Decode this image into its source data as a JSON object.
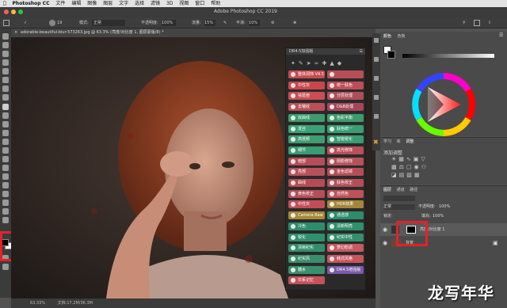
{
  "menubar": {
    "apple": "",
    "app": "Photoshop CC",
    "items": [
      "文件",
      "编辑",
      "图像",
      "图层",
      "文字",
      "选择",
      "滤镜",
      "3D",
      "视图",
      "窗口",
      "帮助"
    ]
  },
  "window": {
    "title": "Adobe Photoshop CC 2019"
  },
  "options": {
    "brush_size": "19",
    "mode_label": "模式:",
    "mode_value": "正常",
    "opacity_label": "不透明度:",
    "opacity_value": "100%",
    "flow_label": "流量:",
    "flow_value": "15%",
    "smooth_label": "平滑:",
    "smooth_value": "10%"
  },
  "document": {
    "tab": "adorable-beautiful-blur-573263.jpg @ 63.3% (亮度/对比度 1, 图层蒙版/8) *"
  },
  "status": {
    "zoom": "63.33%",
    "doc": "文档:17.2M/36.3M"
  },
  "plugin": {
    "title": "DR4.5加强版",
    "left_buttons": [
      {
        "label": "整体润饰 V4.5",
        "color": "#c94a4e"
      },
      {
        "label": "中性灰",
        "color": "#c9474c"
      },
      {
        "label": "祛斑痘",
        "color": "#c94f55"
      },
      {
        "label": "去皱纹",
        "color": "#ba4f57"
      },
      {
        "label": "双曲线",
        "color": "#3f9b6e"
      },
      {
        "label": "发丝",
        "color": "#3aa276"
      },
      {
        "label": "高低频",
        "color": "#3e9d71"
      },
      {
        "label": "细节",
        "color": "#3a9c73"
      },
      {
        "label": "暗部",
        "color": "#b54e59"
      },
      {
        "label": "亮部",
        "color": "#b6525a"
      },
      {
        "label": "曲线",
        "color": "#b64b54"
      },
      {
        "label": "黄色校正",
        "color": "#b54e58"
      },
      {
        "label": "中性灰",
        "color": "#c34d55"
      },
      {
        "label": "Camera Raw",
        "color": "#a98838"
      },
      {
        "label": "冷色",
        "color": "#2d8c6c"
      },
      {
        "label": "锐化",
        "color": "#2f8f6e"
      },
      {
        "label": "清晰纪实",
        "color": "#338e6d"
      },
      {
        "label": "纪实风",
        "color": "#3a8e6c"
      },
      {
        "label": "糖水",
        "color": "#3a8f6e"
      },
      {
        "label": "日系记忆",
        "color": "#c4525a"
      }
    ],
    "right_buttons": [
      {
        "label": "",
        "color": "#b94e57"
      },
      {
        "label": "统一肤色",
        "color": "#bd4e57"
      },
      {
        "label": "分层处理",
        "color": "#ad4f5a"
      },
      {
        "label": "D&B处理",
        "color": "#a4475a"
      },
      {
        "label": "色彩平衡",
        "color": "#3f9b6e"
      },
      {
        "label": "肤色统一",
        "color": "#3a9e73"
      },
      {
        "label": "智能锐化",
        "color": "#3a9c73"
      },
      {
        "label": "高光修饰",
        "color": "#b85059"
      },
      {
        "label": "阴影修饰",
        "color": "#b6535a"
      },
      {
        "label": "金色滤镜",
        "color": "#b54d57"
      },
      {
        "label": "肤色校正",
        "color": "#b34d58"
      },
      {
        "label": "自然色",
        "color": "#be525a"
      },
      {
        "label": "HDR效果",
        "color": "#a58638"
      },
      {
        "label": "通透感",
        "color": "#2d8c6c"
      },
      {
        "label": "清新明亮",
        "color": "#2f8f6e"
      },
      {
        "label": "纪实中性",
        "color": "#358e6d"
      },
      {
        "label": "梦幻粉调",
        "color": "#c55a62"
      },
      {
        "label": "韩式风格",
        "color": "#c6565d"
      },
      {
        "label": "DR4.5增强版",
        "color": "#7a5aa8"
      }
    ]
  },
  "color_panel": {
    "tabs": [
      "颜色",
      "色板"
    ]
  },
  "adjust_panel": {
    "tabs": [
      "学习",
      "库",
      "调整"
    ],
    "add_label": "添加调整"
  },
  "layers_panel": {
    "tabs": [
      "图层",
      "通道",
      "路径"
    ],
    "blend": "正常",
    "opacity_label": "不透明度:",
    "opacity_value": "100%",
    "lock_label": "锁定:",
    "fill_label": "填充:",
    "fill_value": "100%",
    "layer1_name": "亮度/对比度 1",
    "layer2_name": "背景"
  },
  "watermark": "龙写年华"
}
